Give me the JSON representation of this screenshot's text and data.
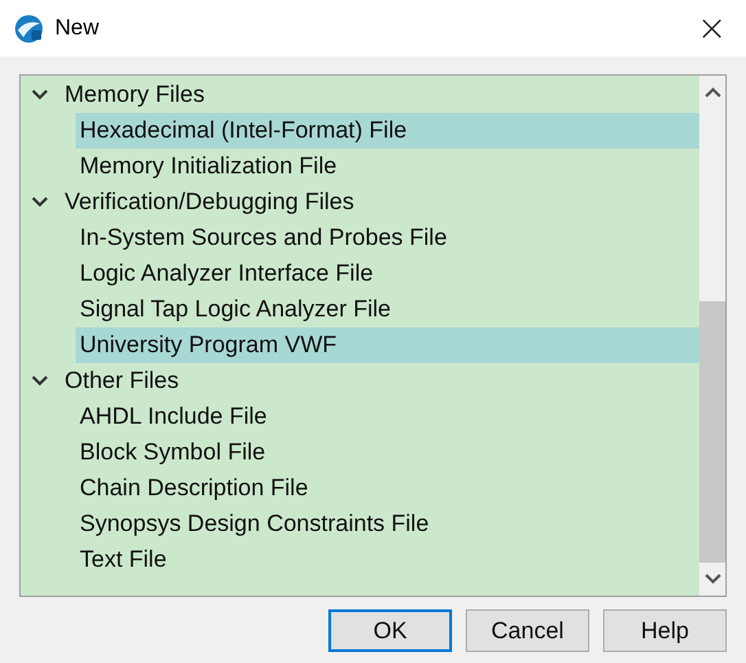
{
  "window": {
    "title": "New",
    "close": "×"
  },
  "tree": [
    {
      "label": "Memory Files",
      "expanded": true,
      "children": [
        {
          "label": "Hexadecimal (Intel-Format) File",
          "selected": true
        },
        {
          "label": "Memory Initialization File",
          "selected": false
        }
      ]
    },
    {
      "label": "Verification/Debugging Files",
      "expanded": true,
      "children": [
        {
          "label": "In-System Sources and Probes File",
          "selected": false
        },
        {
          "label": "Logic Analyzer Interface File",
          "selected": false
        },
        {
          "label": "Signal Tap Logic Analyzer File",
          "selected": false
        },
        {
          "label": "University Program VWF",
          "selected": true
        }
      ]
    },
    {
      "label": "Other Files",
      "expanded": true,
      "children": [
        {
          "label": "AHDL Include File",
          "selected": false
        },
        {
          "label": "Block Symbol File",
          "selected": false
        },
        {
          "label": "Chain Description File",
          "selected": false
        },
        {
          "label": "Synopsys Design Constraints File",
          "selected": false
        },
        {
          "label": "Text File",
          "selected": false
        }
      ]
    }
  ],
  "buttons": [
    {
      "label": "OK",
      "focused": true
    },
    {
      "label": "Cancel",
      "focused": false
    },
    {
      "label": "Help",
      "focused": false
    }
  ]
}
